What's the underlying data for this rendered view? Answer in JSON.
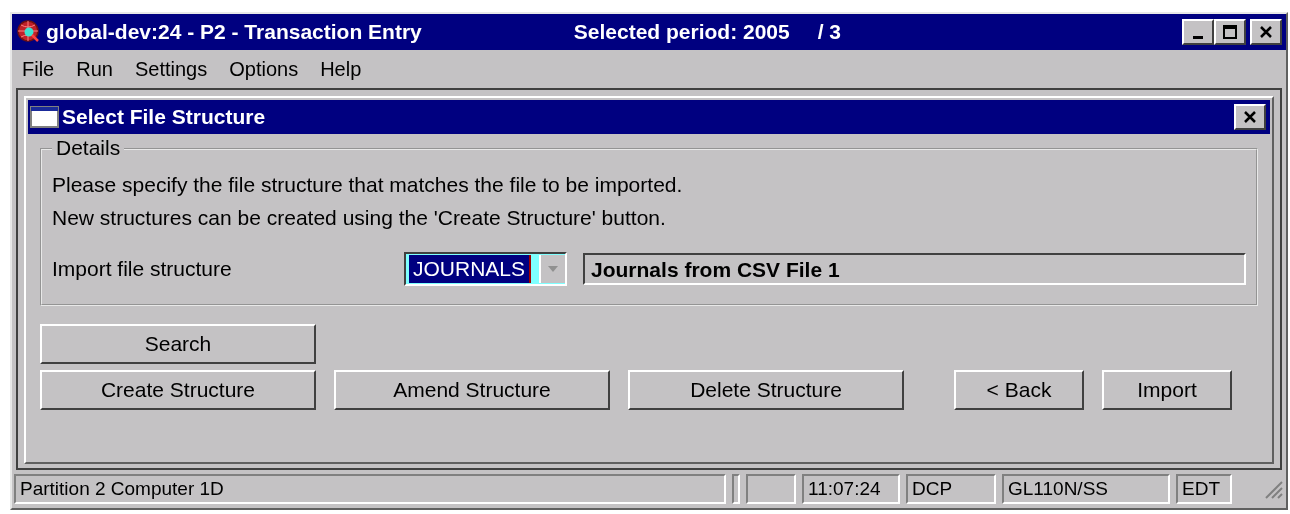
{
  "window": {
    "title": "global-dev:24 - P2 - Transaction Entry",
    "period_label": "Selected period: 2005",
    "period_number": "/ 3"
  },
  "menu": [
    "File",
    "Run",
    "Settings",
    "Options",
    "Help"
  ],
  "dialog": {
    "title": "Select File Structure",
    "group_label": "Details",
    "instructions": [
      "Please specify the file structure that matches the file to be imported.",
      "New structures can be created using the 'Create Structure' button."
    ],
    "field_label": "Import file structure",
    "field_value": "JOURNALS",
    "field_description": "Journals from CSV File 1",
    "search_button": "Search",
    "buttons": [
      "Create Structure",
      "Amend Structure",
      "Delete Structure",
      "< Back",
      "Import"
    ]
  },
  "status_bar": [
    {
      "text": "Partition 2 Computer 1D",
      "kind": "wide"
    },
    {
      "text": "11:07:24",
      "kind": "time"
    },
    {
      "text": "DCP",
      "kind": "mid"
    },
    {
      "text": "GL110N/SS",
      "kind": "code"
    },
    {
      "text": "EDT",
      "kind": "small"
    }
  ]
}
